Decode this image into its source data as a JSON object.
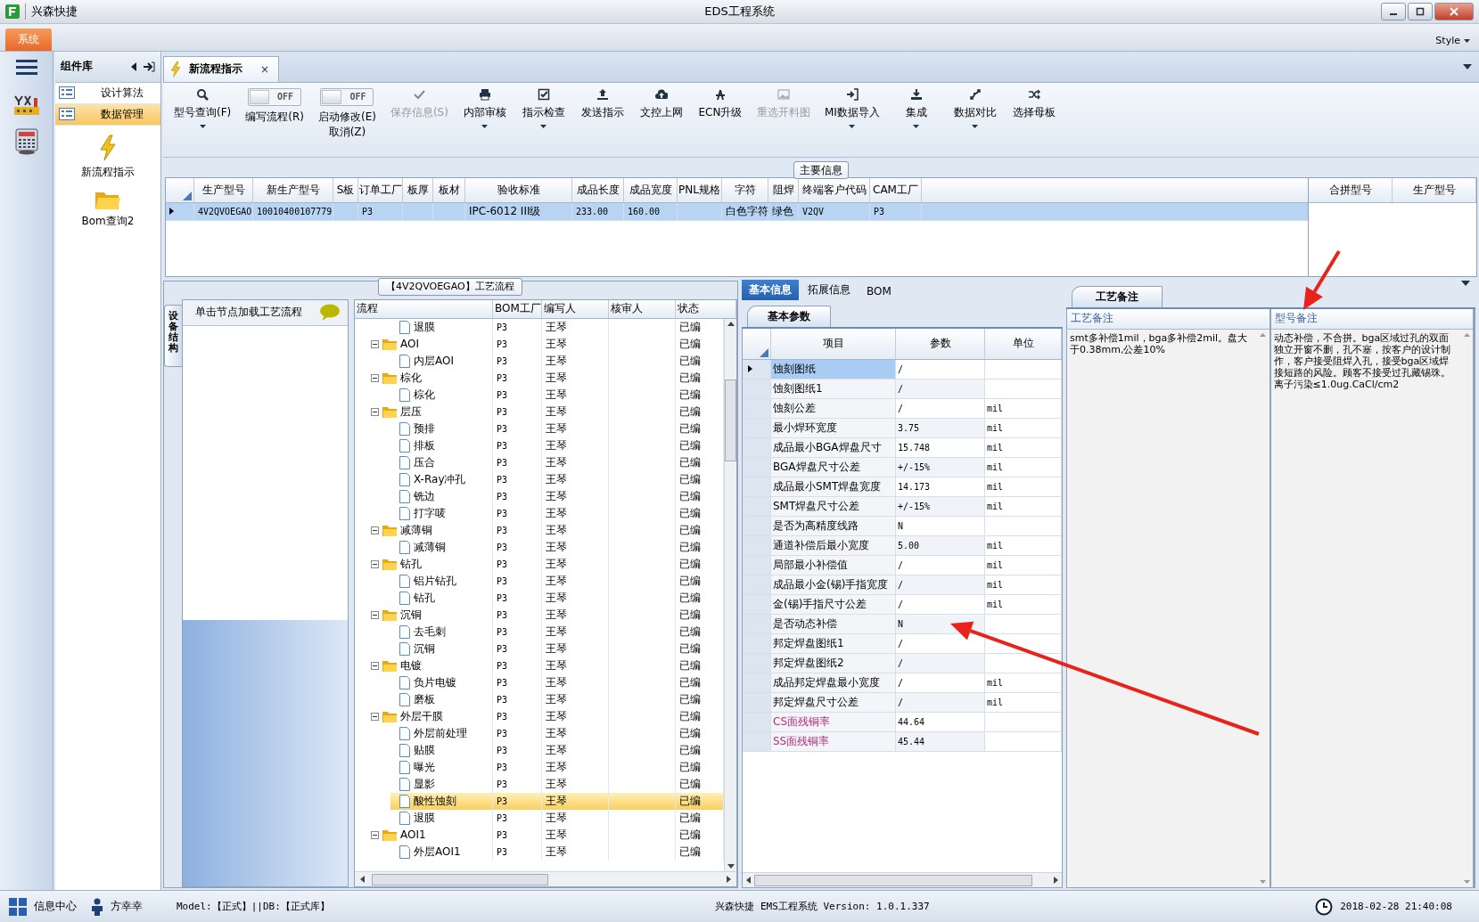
{
  "window": {
    "title": "EDS工程系统",
    "app_name": "兴森快捷"
  },
  "menu": {
    "system_tab": "系统",
    "style_menu": "Style"
  },
  "component_panel": {
    "title": "组件库",
    "items": [
      {
        "label": "设计算法",
        "selected": false
      },
      {
        "label": "数据管理",
        "selected": true
      }
    ],
    "launchers": [
      {
        "label": "新流程指示"
      },
      {
        "label": "Bom查询2"
      }
    ]
  },
  "document_tab": {
    "label": "新流程指示",
    "close": "×"
  },
  "toolbar": [
    {
      "kind": "button",
      "label": "型号查询(F)",
      "dropdown": true,
      "disabled": false
    },
    {
      "kind": "toggle",
      "label": "编写流程(R)",
      "on": false,
      "state_text": "OFF"
    },
    {
      "kind": "toggle",
      "label": "启动修改(E)\n取消(Z)",
      "on": false,
      "state_text": "OFF"
    },
    {
      "kind": "button",
      "label": "保存信息(S)",
      "dropdown": false,
      "disabled": true
    },
    {
      "kind": "button",
      "label": "内部审核",
      "dropdown": true,
      "disabled": false
    },
    {
      "kind": "button",
      "label": "指示检查",
      "dropdown": true,
      "disabled": false
    },
    {
      "kind": "button",
      "label": "发送指示",
      "dropdown": false,
      "disabled": false
    },
    {
      "kind": "button",
      "label": "文控上网",
      "dropdown": false,
      "disabled": false
    },
    {
      "kind": "button",
      "label": "ECN升级",
      "dropdown": false,
      "disabled": false
    },
    {
      "kind": "button",
      "label": "重选开料图",
      "dropdown": false,
      "disabled": true
    },
    {
      "kind": "button",
      "label": "MI数据导入",
      "dropdown": true,
      "disabled": false
    },
    {
      "kind": "button",
      "label": "集成",
      "dropdown": true,
      "disabled": false
    },
    {
      "kind": "button",
      "label": "数据对比",
      "dropdown": true,
      "disabled": false
    },
    {
      "kind": "button",
      "label": "选择母板",
      "dropdown": false,
      "disabled": false
    }
  ],
  "main_info": {
    "title": "主要信息",
    "columns": [
      "生产型号",
      "新生产型号",
      "S板",
      "订单工厂",
      "板厚",
      "板材",
      "验收标准",
      "成品长度",
      "成品宽度",
      "PNL规格",
      "字符",
      "阻焊",
      "终端客户代码",
      "CAM工厂"
    ],
    "rows": [
      {
        "selected": true,
        "cells": [
          "4V2QVOEGAO",
          "10010400107779",
          "",
          "P3",
          "",
          "",
          "IPC-6012 III级",
          "233.00",
          "160.00",
          "",
          "白色字符",
          "绿色",
          "V2QV",
          "P3"
        ]
      }
    ],
    "side_columns": [
      "合拼型号",
      "生产型号"
    ]
  },
  "process": {
    "title": "【4V2QVOEGAO】工艺流程",
    "side_tab": "设备结构",
    "hint": "单击节点加载工艺流程",
    "columns": [
      "流程",
      "BOM工厂",
      "编写人",
      "核审人",
      "状态"
    ],
    "tree": [
      {
        "kind": "file",
        "label": "退膜",
        "factory": "P3",
        "writer": "王琴",
        "status": "已编",
        "selected": false
      },
      {
        "kind": "folder",
        "label": "AOI",
        "factory": "P3",
        "writer": "王琴",
        "status": "已编",
        "selected": false,
        "expanded": true,
        "children": [
          {
            "kind": "file",
            "label": "内层AOI",
            "factory": "P3",
            "writer": "王琴",
            "status": "已编",
            "selected": false
          }
        ]
      },
      {
        "kind": "folder",
        "label": "棕化",
        "factory": "P3",
        "writer": "王琴",
        "status": "已编",
        "selected": false,
        "expanded": true,
        "children": [
          {
            "kind": "file",
            "label": "棕化",
            "factory": "P3",
            "writer": "王琴",
            "status": "已编",
            "selected": false
          }
        ]
      },
      {
        "kind": "folder",
        "label": "层压",
        "factory": "P3",
        "writer": "王琴",
        "status": "已编",
        "selected": false,
        "expanded": true,
        "children": [
          {
            "kind": "file",
            "label": "预排",
            "factory": "P3",
            "writer": "王琴",
            "status": "已编",
            "selected": false
          },
          {
            "kind": "file",
            "label": "排板",
            "factory": "P3",
            "writer": "王琴",
            "status": "已编",
            "selected": false
          },
          {
            "kind": "file",
            "label": "压合",
            "factory": "P3",
            "writer": "王琴",
            "status": "已编",
            "selected": false
          },
          {
            "kind": "file",
            "label": "X-Ray冲孔",
            "factory": "P3",
            "writer": "王琴",
            "status": "已编",
            "selected": false
          },
          {
            "kind": "file",
            "label": "铣边",
            "factory": "P3",
            "writer": "王琴",
            "status": "已编",
            "selected": false
          },
          {
            "kind": "file",
            "label": "打字唛",
            "factory": "P3",
            "writer": "王琴",
            "status": "已编",
            "selected": false
          }
        ]
      },
      {
        "kind": "folder",
        "label": "减薄铜",
        "factory": "P3",
        "writer": "王琴",
        "status": "已编",
        "selected": false,
        "expanded": true,
        "children": [
          {
            "kind": "file",
            "label": "减薄铜",
            "factory": "P3",
            "writer": "王琴",
            "status": "已编",
            "selected": false
          }
        ]
      },
      {
        "kind": "folder",
        "label": "钻孔",
        "factory": "P3",
        "writer": "王琴",
        "status": "已编",
        "selected": false,
        "expanded": true,
        "children": [
          {
            "kind": "file",
            "label": "铝片钻孔",
            "factory": "P3",
            "writer": "王琴",
            "status": "已编",
            "selected": false
          },
          {
            "kind": "file",
            "label": "钻孔",
            "factory": "P3",
            "writer": "王琴",
            "status": "已编",
            "selected": false
          }
        ]
      },
      {
        "kind": "folder",
        "label": "沉铜",
        "factory": "P3",
        "writer": "王琴",
        "status": "已编",
        "selected": false,
        "expanded": true,
        "children": [
          {
            "kind": "file",
            "label": "去毛刺",
            "factory": "P3",
            "writer": "王琴",
            "status": "已编",
            "selected": false
          },
          {
            "kind": "file",
            "label": "沉铜",
            "factory": "P3",
            "writer": "王琴",
            "status": "已编",
            "selected": false
          }
        ]
      },
      {
        "kind": "folder",
        "label": "电镀",
        "factory": "P3",
        "writer": "王琴",
        "status": "已编",
        "selected": false,
        "expanded": true,
        "children": [
          {
            "kind": "file",
            "label": "负片电镀",
            "factory": "P3",
            "writer": "王琴",
            "status": "已编",
            "selected": false
          },
          {
            "kind": "file",
            "label": "磨板",
            "factory": "P3",
            "writer": "王琴",
            "status": "已编",
            "selected": false
          }
        ]
      },
      {
        "kind": "folder",
        "label": "外层干膜",
        "factory": "P3",
        "writer": "王琴",
        "status": "已编",
        "selected": false,
        "expanded": true,
        "children": [
          {
            "kind": "file",
            "label": "外层前处理",
            "factory": "P3",
            "writer": "王琴",
            "status": "已编",
            "selected": false
          },
          {
            "kind": "file",
            "label": "贴膜",
            "factory": "P3",
            "writer": "王琴",
            "status": "已编",
            "selected": false
          },
          {
            "kind": "file",
            "label": "曝光",
            "factory": "P3",
            "writer": "王琴",
            "status": "已编",
            "selected": false
          },
          {
            "kind": "file",
            "label": "显影",
            "factory": "P3",
            "writer": "王琴",
            "status": "已编",
            "selected": false
          },
          {
            "kind": "file",
            "label": "酸性蚀刻",
            "factory": "P3",
            "writer": "王琴",
            "status": "已编",
            "selected": true
          },
          {
            "kind": "file",
            "label": "退膜",
            "factory": "P3",
            "writer": "王琴",
            "status": "已编",
            "selected": false
          }
        ]
      },
      {
        "kind": "folder",
        "label": "AOI1",
        "factory": "P3",
        "writer": "王琴",
        "status": "已编",
        "selected": false,
        "expanded": true,
        "children": [
          {
            "kind": "file",
            "label": "外层AOI1",
            "factory": "P3",
            "writer": "王琴",
            "status": "已编",
            "selected": false
          }
        ]
      }
    ]
  },
  "detail_tabs": [
    {
      "label": "基本信息",
      "selected": true
    },
    {
      "label": "拓展信息",
      "selected": false
    },
    {
      "label": "BOM",
      "selected": false
    }
  ],
  "params": {
    "title": "基本参数",
    "columns": [
      "项目",
      "参数",
      "单位"
    ],
    "rows": [
      {
        "item": "蚀刻图纸",
        "value": "/",
        "unit": "",
        "selected": true,
        "kind": "plain"
      },
      {
        "item": "蚀刻图纸1",
        "value": "/",
        "unit": "",
        "selected": false,
        "kind": "plain"
      },
      {
        "item": "蚀刻公差",
        "value": "/",
        "unit": "mil",
        "selected": false,
        "kind": "plain"
      },
      {
        "item": "最小焊环宽度",
        "value": "3.75",
        "unit": "mil",
        "selected": false,
        "kind": "plain"
      },
      {
        "item": "成品最小BGA焊盘尺寸",
        "value": "15.748",
        "unit": "mil",
        "selected": false,
        "kind": "plain"
      },
      {
        "item": "BGA焊盘尺寸公差",
        "value": "+/-15%",
        "unit": "mil",
        "selected": false,
        "kind": "plain"
      },
      {
        "item": "成品最小SMT焊盘宽度",
        "value": "14.173",
        "unit": "mil",
        "selected": false,
        "kind": "plain"
      },
      {
        "item": "SMT焊盘尺寸公差",
        "value": "+/-15%",
        "unit": "mil",
        "selected": false,
        "kind": "plain"
      },
      {
        "item": "是否为高精度线路",
        "value": "N",
        "unit": "",
        "selected": false,
        "kind": "plain"
      },
      {
        "item": "通道补偿后最小宽度",
        "value": "5.00",
        "unit": "mil",
        "selected": false,
        "kind": "plain"
      },
      {
        "item": "局部最小补偿值",
        "value": "/",
        "unit": "mil",
        "selected": false,
        "kind": "plain"
      },
      {
        "item": "成品最小金(锡)手指宽度",
        "value": "/",
        "unit": "mil",
        "selected": false,
        "kind": "plain"
      },
      {
        "item": "金(锡)手指尺寸公差",
        "value": "/",
        "unit": "mil",
        "selected": false,
        "kind": "plain"
      },
      {
        "item": "是否动态补偿",
        "value": "N",
        "unit": "",
        "selected": false,
        "kind": "plain"
      },
      {
        "item": "邦定焊盘图纸1",
        "value": "/",
        "unit": "",
        "selected": false,
        "kind": "plain"
      },
      {
        "item": "邦定焊盘图纸2",
        "value": "/",
        "unit": "",
        "selected": false,
        "kind": "plain"
      },
      {
        "item": "成品邦定焊盘最小宽度",
        "value": "/",
        "unit": "mil",
        "selected": false,
        "kind": "plain"
      },
      {
        "item": "邦定焊盘尺寸公差",
        "value": "/",
        "unit": "mil",
        "selected": false,
        "kind": "plain"
      },
      {
        "item": "CS面残铜率",
        "value": "44.64",
        "unit": "",
        "selected": false,
        "kind": "ratio"
      },
      {
        "item": "SS面残铜率",
        "value": "45.44",
        "unit": "",
        "selected": false,
        "kind": "ratio"
      }
    ]
  },
  "notes": {
    "title": "工艺备注",
    "columns": [
      {
        "header": "工艺备注",
        "text": "smt多补偿1mil，bga多补偿2mil。盘大于0.38mm,公差10%"
      },
      {
        "header": "型号备注",
        "text": "动态补偿，不合拼。bga区域过孔的双面独立开窗不删，孔不塞，按客户的设计制作，客户接受阻焊入孔，接受bga区域焊接短路的风险。顾客不接受过孔藏锡珠。离子污染≤1.0ug.CaCl/cm2"
      }
    ]
  },
  "markup_arrows": [
    {
      "kind": "arrow"
    },
    {
      "kind": "arrow"
    }
  ],
  "status_bar": {
    "info_center": "信息中心",
    "user": "方幸幸",
    "model": "Model:【正式】||DB:【正式库】",
    "version": "兴森快捷 EMS工程系统 Version: 1.0.1.337",
    "datetime": "2018-02-28 21:40:08"
  }
}
